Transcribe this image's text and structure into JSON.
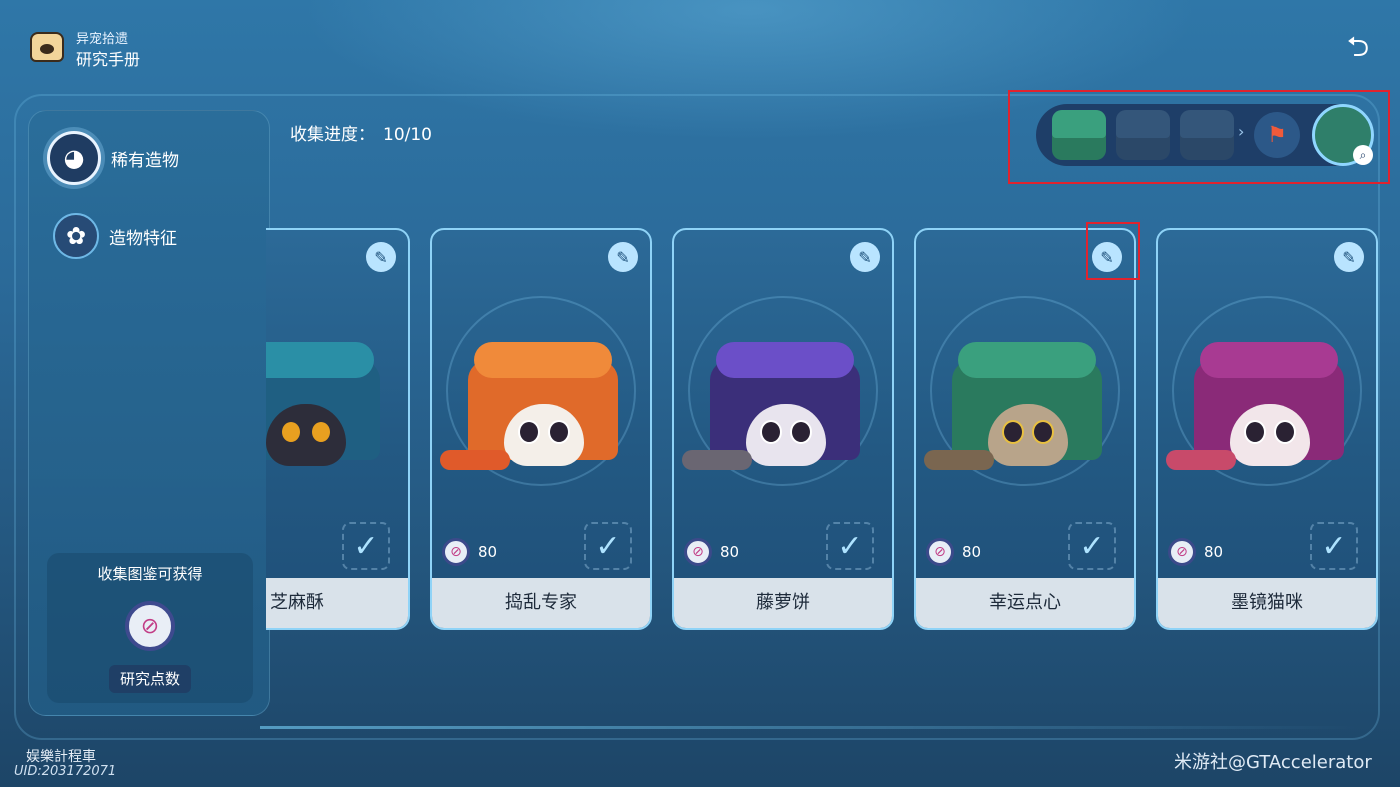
{
  "header": {
    "app_subtitle": "异宠拾遗",
    "app_title": "研究手册",
    "back_icon": "back-arrow-icon"
  },
  "sidebar": {
    "items": [
      {
        "label": "稀有造物",
        "icon": "pet-face-icon",
        "active": true
      },
      {
        "label": "造物特征",
        "icon": "flower-icon",
        "active": false
      }
    ],
    "reward": {
      "title": "收集图鉴可获得",
      "label": "研究点数",
      "icon": "research-point-icon"
    }
  },
  "progress": {
    "label": "收集进度：",
    "value": "10/10"
  },
  "cards": [
    {
      "name": "芝麻酥",
      "cost": "",
      "color": "#1f5f82",
      "rim": "#2a8fa6",
      "tail": "#2d2d3a"
    },
    {
      "name": "捣乱专家",
      "cost": "80",
      "color": "#e06a2a",
      "rim": "#f08a3a",
      "tail": "#e05a2a"
    },
    {
      "name": "藤萝饼",
      "cost": "80",
      "color": "#3b2f7a",
      "rim": "#6b4fc8",
      "tail": "#6a6672"
    },
    {
      "name": "幸运点心",
      "cost": "80",
      "color": "#2a7a5e",
      "rim": "#3aa07e",
      "tail": "#7a6650"
    },
    {
      "name": "墨镜猫咪",
      "cost": "80",
      "color": "#8a2a78",
      "rim": "#a83a92",
      "tail": "#c84a6a"
    }
  ],
  "watermark": "米游社@GTAccelerator",
  "uid": "娱樂計程車",
  "uid_small": "UID:203172071"
}
